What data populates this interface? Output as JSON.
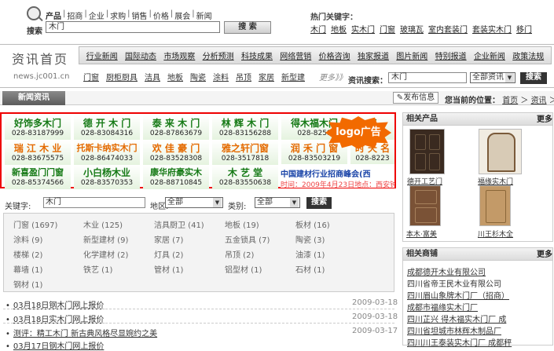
{
  "top": {
    "nav": [
      "产品",
      "招商",
      "企业",
      "求购",
      "销售",
      "价格",
      "展会",
      "新闻"
    ],
    "search_label": "搜索",
    "search_value": "木门",
    "search_button": "搜 索",
    "hot_label": "热门关键字：",
    "hot_links": [
      "木门",
      "地板",
      "实木门",
      "门窗",
      "玻璃瓦",
      "室内套装门",
      "套装实木门",
      "移门"
    ]
  },
  "channel": {
    "title": "资讯首页",
    "url": "news.jc001.cn",
    "row1": [
      "行业新闻",
      "国际动态",
      "市场观察",
      "分析预测",
      "科技成果",
      "网络营销",
      "价格咨询",
      "独家报道",
      "图片新闻",
      "特别报道",
      "企业新闻",
      "政策法规"
    ],
    "row2": [
      "门窗",
      "厨柜厨具",
      "洁具",
      "地板",
      "陶瓷",
      "涂料",
      "吊顶",
      "家居",
      "新型建"
    ],
    "more": "更多》》",
    "info_search_label": "资讯搜索：",
    "info_search_value": "木门",
    "info_select": "全部资讯",
    "info_button": "搜索"
  },
  "section": {
    "tab": "新闻资讯",
    "publish": "发布信息",
    "pos_label": "您当前的位置：",
    "crumb_home": "首页",
    "crumb_sep": "＞",
    "crumb_cur": "资讯",
    "crumb_tail": "＞"
  },
  "ads": {
    "logo_text": "logo广告",
    "row1": [
      {
        "name": "好饰多木门",
        "phone": "028-83187999"
      },
      {
        "name": "德 开 木 门",
        "phone": "028-83084316"
      },
      {
        "name": "泰 来 木 门",
        "phone": "028-87863679"
      },
      {
        "name": "林 辉 木 门",
        "phone": "028-83156288"
      },
      {
        "name": "得木福木门",
        "phone": "028-8258"
      },
      {
        "name": "来",
        "phone": ""
      }
    ],
    "row2": [
      {
        "name": "瑞 江 木 业",
        "phone": "028-83675575"
      },
      {
        "name": "托斯卡纳实木门",
        "phone": "028-86474033"
      },
      {
        "name": "欢 佳 豪 门",
        "phone": "028-83528308"
      },
      {
        "name": "雅之轩门窗",
        "phone": "028-3517818"
      },
      {
        "name": "润 禾 门 窗",
        "phone": "028-83503219"
      },
      {
        "name": "时 天 名",
        "phone": "028-8223"
      }
    ],
    "row3": [
      {
        "name": "新喜盈门门窗",
        "phone": "028-85374566"
      },
      {
        "name": "小白杨木业",
        "phone": "028-83570353"
      },
      {
        "name": "康华府豪实木",
        "phone": "028-88710845"
      },
      {
        "name": "木 艺 堂",
        "phone": "028-83550638"
      }
    ],
    "big_title": "中国建材行业招商峰会(西",
    "big_sub": "时间：2009年4月23日地点：西安钟"
  },
  "filter": {
    "keyword_label": "关键字:",
    "keyword_value": "木门",
    "area_label": "地区:",
    "area_value": "全部",
    "cat_label": "类别:",
    "cat_value": "全部",
    "button": "搜索"
  },
  "categories": [
    [
      "门窗 (1697)",
      "木业 (125)",
      "洁具厨卫 (41)",
      "地板 (19)",
      "板材 (16)"
    ],
    [
      "涂料 (9)",
      "新型建材 (9)",
      "家居 (7)",
      "五金锁具 (7)",
      "陶瓷 (3)"
    ],
    [
      "楼梯 (2)",
      "化学建材 (2)",
      "灯具 (2)",
      "吊顶 (2)",
      "油漆 (1)"
    ],
    [
      "幕墙 (1)",
      "铁艺 (1)",
      "管材 (1)",
      "铝型材 (1)",
      "石材 (1)"
    ],
    [
      "钢材 (1)"
    ]
  ],
  "news": [
    {
      "title": "03月18日钢木门网上报价",
      "date": "2009-03-18"
    },
    {
      "title": "03月18日实木门网上报价",
      "date": "2009-03-18"
    },
    {
      "title": "测评：精工木门 新古典风格尽显婉约之美",
      "date": "2009-03-17"
    },
    {
      "title": "03月17日钢木门网上报价",
      "date": "2009-03-17"
    }
  ],
  "right": {
    "products_title": "相关产品",
    "more": "更多",
    "products": [
      "德开工艺门",
      "福缘实木门",
      "本木·富美",
      "川王杉木全"
    ],
    "merchants_title": "相关商铺",
    "merchants": [
      "成都德开木业有限公司",
      "四川省帝王民木业有限公司",
      "四川眉山象牌木门厂（招商）",
      "成都市福缘实木门厂",
      "四川芷兴 得木福实木门厂 成",
      "四川省坦城市林辉木制品厂",
      "四川川王泰装实木门厂 成都秤"
    ]
  }
}
